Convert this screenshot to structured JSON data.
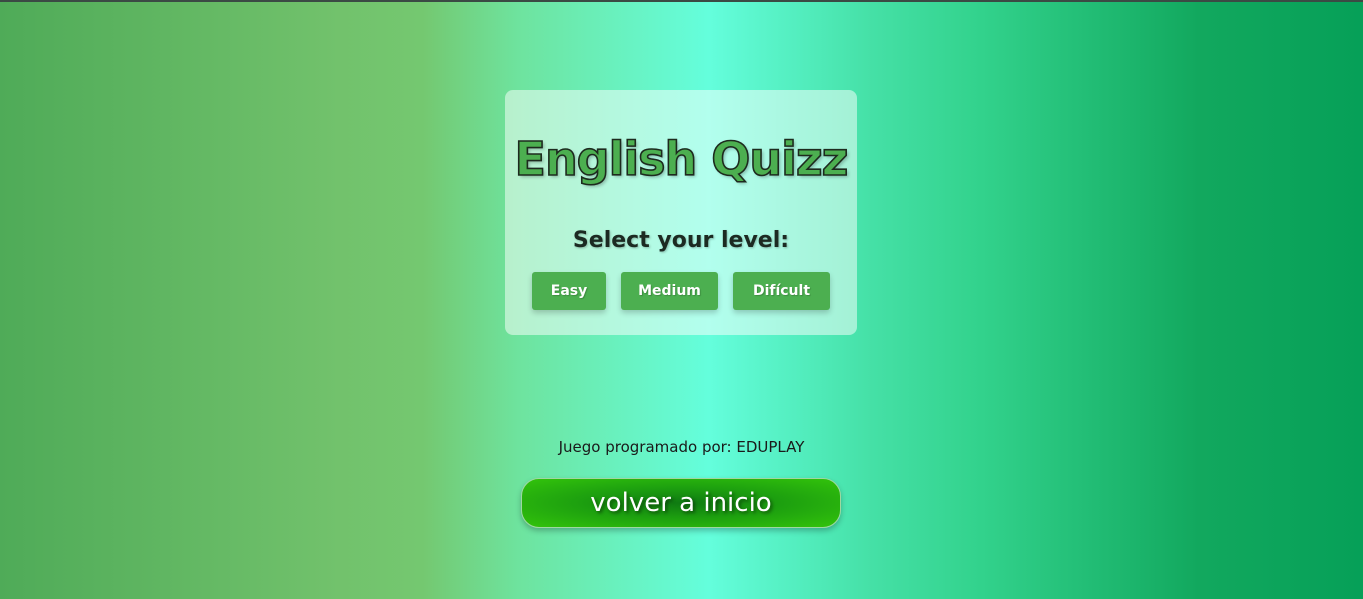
{
  "quiz": {
    "title": "English Quizz",
    "subtitle": "Select your level:",
    "levels": [
      {
        "label": "Easy"
      },
      {
        "label": "Medium"
      },
      {
        "label": "Difícult"
      }
    ]
  },
  "footer": {
    "credit": "Juego programado por: EDUPLAY",
    "home_button": "volver a inicio"
  },
  "colors": {
    "accent_green": "#4caf50",
    "home_button_green": "#1da00f",
    "background_mid": "#64fedc"
  }
}
